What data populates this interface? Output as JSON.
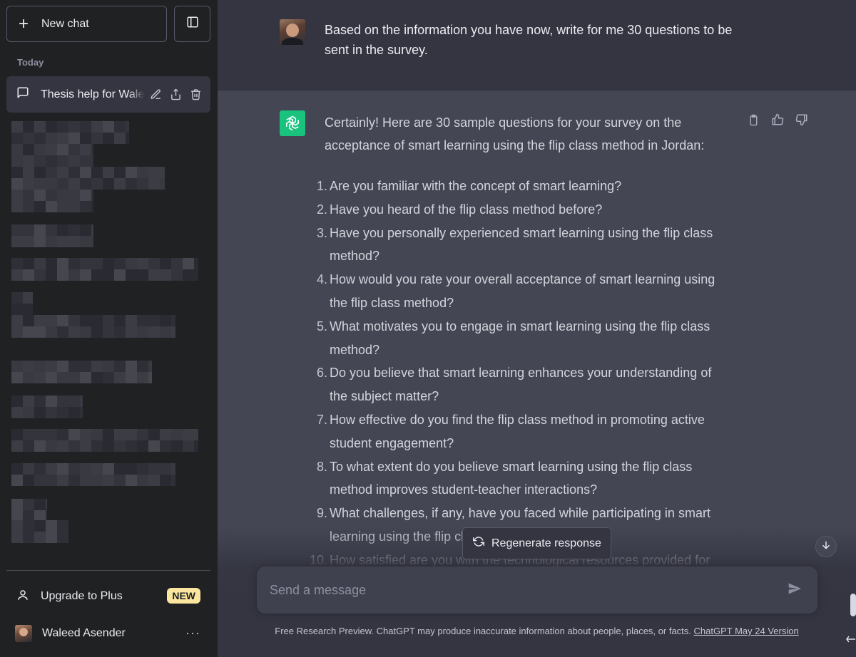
{
  "sidebar": {
    "new_chat_label": "New chat",
    "section_label": "Today",
    "active_chat_title": "Thesis help for Waleed",
    "upgrade_label": "Upgrade to Plus",
    "upgrade_badge": "NEW",
    "user_name": "Waleed Asender",
    "more_label": "···"
  },
  "conversation": {
    "user_prompt": "Based on the information you have now, write for me 30 questions to be sent in the survey.",
    "assistant_intro": "Certainly! Here are 30 sample questions for your survey on the acceptance of smart learning using the flip class method in Jordan:",
    "questions": [
      {
        "num": "1.",
        "text": "Are you familiar with the concept of smart learning?"
      },
      {
        "num": "2.",
        "text": "Have you heard of the flip class method before?"
      },
      {
        "num": "3.",
        "text": "Have you personally experienced smart learning using the flip class method?"
      },
      {
        "num": "4.",
        "text": "How would you rate your overall acceptance of smart learning using the flip class method?"
      },
      {
        "num": "5.",
        "text": "What motivates you to engage in smart learning using the flip class method?"
      },
      {
        "num": "6.",
        "text": "Do you believe that smart learning enhances your understanding of the subject matter?"
      },
      {
        "num": "7.",
        "text": "How effective do you find the flip class method in promoting active student engagement?"
      },
      {
        "num": "8.",
        "text": "To what extent do you believe smart learning using the flip class method improves student-teacher interactions?"
      },
      {
        "num": "9.",
        "text": "What challenges, if any, have you faced while participating in smart learning using the flip class method?"
      },
      {
        "num": "10.",
        "text": "How satisfied are you with the technological resources provided for"
      }
    ]
  },
  "controls": {
    "regenerate_label": "Regenerate response",
    "composer_placeholder": "Send a message"
  },
  "footer": {
    "disclaimer": "Free Research Preview. ChatGPT may produce inaccurate information about people, places, or facts.",
    "version_link": "ChatGPT May 24 Version"
  },
  "colors": {
    "sidebar_bg": "#202123",
    "main_bg": "#343541",
    "assistant_bg": "#444654",
    "brand_green": "#19c37d",
    "badge_yellow": "#fae69e"
  },
  "icons": {
    "new_chat": "plus-icon",
    "toggle_sidebar": "sidebar-toggle-icon",
    "chat": "chat-bubble-icon",
    "edit": "pencil-icon",
    "share": "share-icon",
    "delete": "trash-icon",
    "upgrade": "user-icon",
    "copy": "clipboard-icon",
    "like": "thumbs-up-icon",
    "dislike": "thumbs-down-icon",
    "regenerate": "refresh-icon",
    "scroll": "arrow-down-icon",
    "send": "send-icon"
  }
}
